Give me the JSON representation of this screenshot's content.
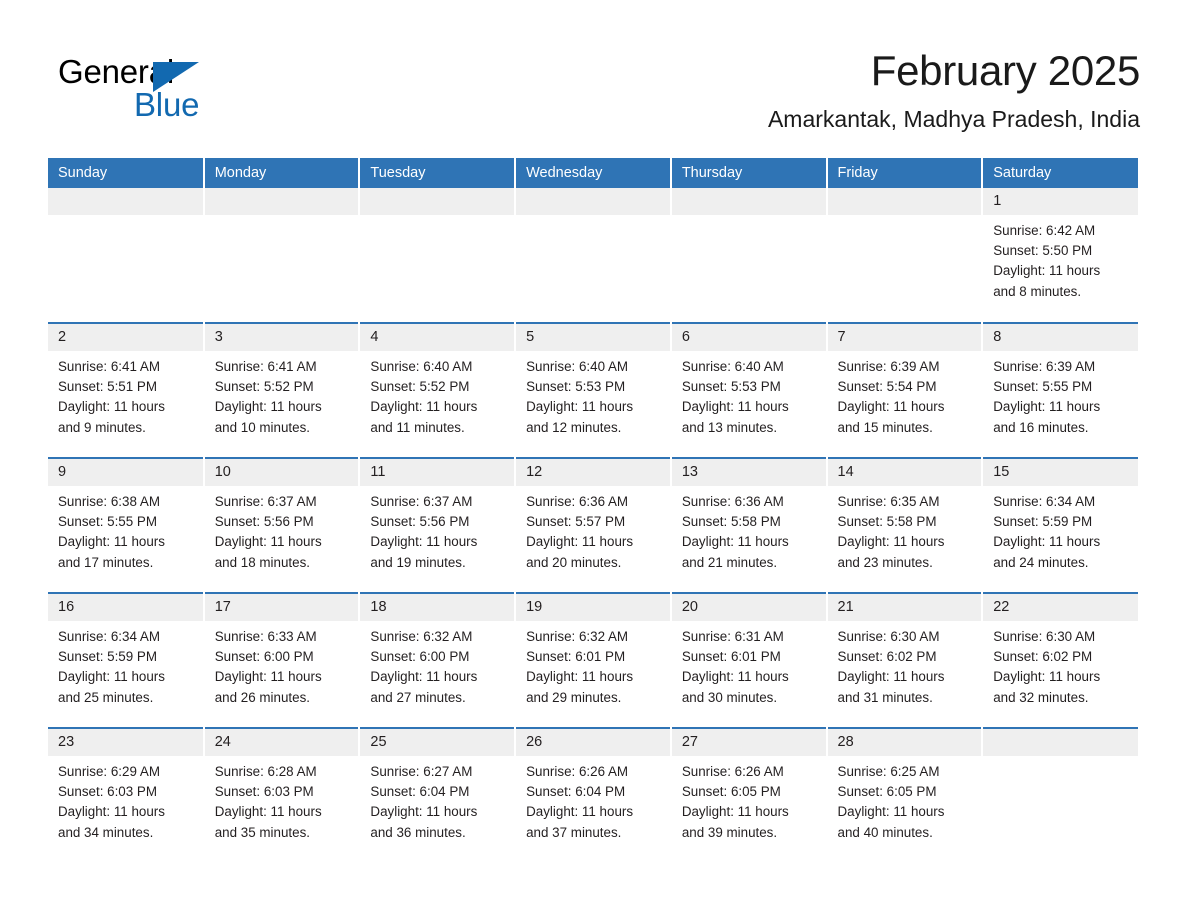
{
  "brand": {
    "name_part1": "General",
    "name_part2": "Blue",
    "accent_color": "#1269b0",
    "triangle_icon": "right-triangle-icon"
  },
  "header": {
    "title": "February 2025",
    "subtitle": "Amarkantak, Madhya Pradesh, India"
  },
  "colors": {
    "header_row_bg": "#2f74b5",
    "day_number_bg": "#efefef",
    "row_divider": "#2f74b5",
    "text": "#231f20"
  },
  "weekday_headers": [
    "Sunday",
    "Monday",
    "Tuesday",
    "Wednesday",
    "Thursday",
    "Friday",
    "Saturday"
  ],
  "weeks": [
    [
      {
        "day": "",
        "info": "",
        "empty": true
      },
      {
        "day": "",
        "info": "",
        "empty": true
      },
      {
        "day": "",
        "info": "",
        "empty": true
      },
      {
        "day": "",
        "info": "",
        "empty": true
      },
      {
        "day": "",
        "info": "",
        "empty": true
      },
      {
        "day": "",
        "info": "",
        "empty": true
      },
      {
        "day": "1",
        "info": "Sunrise: 6:42 AM\nSunset: 5:50 PM\nDaylight: 11 hours\nand 8 minutes.",
        "empty": false
      }
    ],
    [
      {
        "day": "2",
        "info": "Sunrise: 6:41 AM\nSunset: 5:51 PM\nDaylight: 11 hours\nand 9 minutes.",
        "empty": false
      },
      {
        "day": "3",
        "info": "Sunrise: 6:41 AM\nSunset: 5:52 PM\nDaylight: 11 hours\nand 10 minutes.",
        "empty": false
      },
      {
        "day": "4",
        "info": "Sunrise: 6:40 AM\nSunset: 5:52 PM\nDaylight: 11 hours\nand 11 minutes.",
        "empty": false
      },
      {
        "day": "5",
        "info": "Sunrise: 6:40 AM\nSunset: 5:53 PM\nDaylight: 11 hours\nand 12 minutes.",
        "empty": false
      },
      {
        "day": "6",
        "info": "Sunrise: 6:40 AM\nSunset: 5:53 PM\nDaylight: 11 hours\nand 13 minutes.",
        "empty": false
      },
      {
        "day": "7",
        "info": "Sunrise: 6:39 AM\nSunset: 5:54 PM\nDaylight: 11 hours\nand 15 minutes.",
        "empty": false
      },
      {
        "day": "8",
        "info": "Sunrise: 6:39 AM\nSunset: 5:55 PM\nDaylight: 11 hours\nand 16 minutes.",
        "empty": false
      }
    ],
    [
      {
        "day": "9",
        "info": "Sunrise: 6:38 AM\nSunset: 5:55 PM\nDaylight: 11 hours\nand 17 minutes.",
        "empty": false
      },
      {
        "day": "10",
        "info": "Sunrise: 6:37 AM\nSunset: 5:56 PM\nDaylight: 11 hours\nand 18 minutes.",
        "empty": false
      },
      {
        "day": "11",
        "info": "Sunrise: 6:37 AM\nSunset: 5:56 PM\nDaylight: 11 hours\nand 19 minutes.",
        "empty": false
      },
      {
        "day": "12",
        "info": "Sunrise: 6:36 AM\nSunset: 5:57 PM\nDaylight: 11 hours\nand 20 minutes.",
        "empty": false
      },
      {
        "day": "13",
        "info": "Sunrise: 6:36 AM\nSunset: 5:58 PM\nDaylight: 11 hours\nand 21 minutes.",
        "empty": false
      },
      {
        "day": "14",
        "info": "Sunrise: 6:35 AM\nSunset: 5:58 PM\nDaylight: 11 hours\nand 23 minutes.",
        "empty": false
      },
      {
        "day": "15",
        "info": "Sunrise: 6:34 AM\nSunset: 5:59 PM\nDaylight: 11 hours\nand 24 minutes.",
        "empty": false
      }
    ],
    [
      {
        "day": "16",
        "info": "Sunrise: 6:34 AM\nSunset: 5:59 PM\nDaylight: 11 hours\nand 25 minutes.",
        "empty": false
      },
      {
        "day": "17",
        "info": "Sunrise: 6:33 AM\nSunset: 6:00 PM\nDaylight: 11 hours\nand 26 minutes.",
        "empty": false
      },
      {
        "day": "18",
        "info": "Sunrise: 6:32 AM\nSunset: 6:00 PM\nDaylight: 11 hours\nand 27 minutes.",
        "empty": false
      },
      {
        "day": "19",
        "info": "Sunrise: 6:32 AM\nSunset: 6:01 PM\nDaylight: 11 hours\nand 29 minutes.",
        "empty": false
      },
      {
        "day": "20",
        "info": "Sunrise: 6:31 AM\nSunset: 6:01 PM\nDaylight: 11 hours\nand 30 minutes.",
        "empty": false
      },
      {
        "day": "21",
        "info": "Sunrise: 6:30 AM\nSunset: 6:02 PM\nDaylight: 11 hours\nand 31 minutes.",
        "empty": false
      },
      {
        "day": "22",
        "info": "Sunrise: 6:30 AM\nSunset: 6:02 PM\nDaylight: 11 hours\nand 32 minutes.",
        "empty": false
      }
    ],
    [
      {
        "day": "23",
        "info": "Sunrise: 6:29 AM\nSunset: 6:03 PM\nDaylight: 11 hours\nand 34 minutes.",
        "empty": false
      },
      {
        "day": "24",
        "info": "Sunrise: 6:28 AM\nSunset: 6:03 PM\nDaylight: 11 hours\nand 35 minutes.",
        "empty": false
      },
      {
        "day": "25",
        "info": "Sunrise: 6:27 AM\nSunset: 6:04 PM\nDaylight: 11 hours\nand 36 minutes.",
        "empty": false
      },
      {
        "day": "26",
        "info": "Sunrise: 6:26 AM\nSunset: 6:04 PM\nDaylight: 11 hours\nand 37 minutes.",
        "empty": false
      },
      {
        "day": "27",
        "info": "Sunrise: 6:26 AM\nSunset: 6:05 PM\nDaylight: 11 hours\nand 39 minutes.",
        "empty": false
      },
      {
        "day": "28",
        "info": "Sunrise: 6:25 AM\nSunset: 6:05 PM\nDaylight: 11 hours\nand 40 minutes.",
        "empty": false
      },
      {
        "day": "",
        "info": "",
        "empty": true
      }
    ]
  ]
}
